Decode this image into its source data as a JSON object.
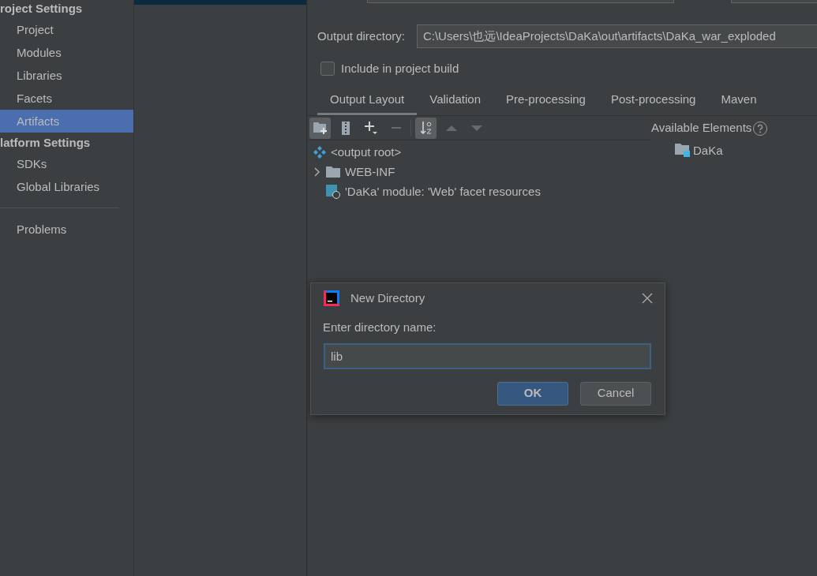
{
  "sidebar": {
    "sections": [
      {
        "title": "roject Settings",
        "items": [
          {
            "label": "Project",
            "selected": false
          },
          {
            "label": "Modules",
            "selected": false
          },
          {
            "label": "Libraries",
            "selected": false
          },
          {
            "label": "Facets",
            "selected": false
          },
          {
            "label": "Artifacts",
            "selected": true
          }
        ]
      },
      {
        "title": "latform Settings",
        "items": [
          {
            "label": "SDKs",
            "selected": false
          },
          {
            "label": "Global Libraries",
            "selected": false
          }
        ]
      },
      {
        "items": [
          {
            "label": "Problems",
            "selected": false
          }
        ]
      }
    ]
  },
  "artifacts": [
    {
      "selected": true
    }
  ],
  "output_directory": {
    "label": "Output directory:",
    "value": "C:\\Users\\也远\\IdeaProjects\\DaKa\\out\\artifacts\\DaKa_war_exploded"
  },
  "include_in_build": {
    "label": "Include in project build",
    "checked": false
  },
  "tabs": [
    {
      "label": "Output Layout",
      "selected": true
    },
    {
      "label": "Validation",
      "selected": false
    },
    {
      "label": "Pre-processing",
      "selected": false
    },
    {
      "label": "Post-processing",
      "selected": false
    },
    {
      "label": "Maven",
      "selected": false
    }
  ],
  "toolbar": {
    "groups": [
      [
        {
          "kind": "new-folder",
          "disabled": false
        },
        {
          "kind": "archive",
          "disabled": false
        },
        {
          "kind": "add",
          "disabled": false
        },
        {
          "kind": "remove",
          "disabled": true
        }
      ],
      [
        {
          "kind": "sort",
          "disabled": false
        },
        {
          "kind": "up",
          "disabled": true
        },
        {
          "kind": "down",
          "disabled": true
        }
      ]
    ]
  },
  "tree": [
    {
      "label": "<output root>",
      "kind": "root"
    },
    {
      "label": "WEB-INF",
      "kind": "folder",
      "expanded": false
    },
    {
      "label": "'DaKa' module: 'Web' facet resources",
      "kind": "facet"
    }
  ],
  "available_elements": {
    "title": "Available Elements",
    "items": [
      {
        "label": "DaKa",
        "kind": "module"
      }
    ]
  },
  "dialog": {
    "title": "New Directory",
    "prompt": "Enter directory name:",
    "value": "lib",
    "buttons": [
      {
        "label": "OK",
        "default": true
      },
      {
        "label": "Cancel",
        "default": false
      }
    ]
  }
}
